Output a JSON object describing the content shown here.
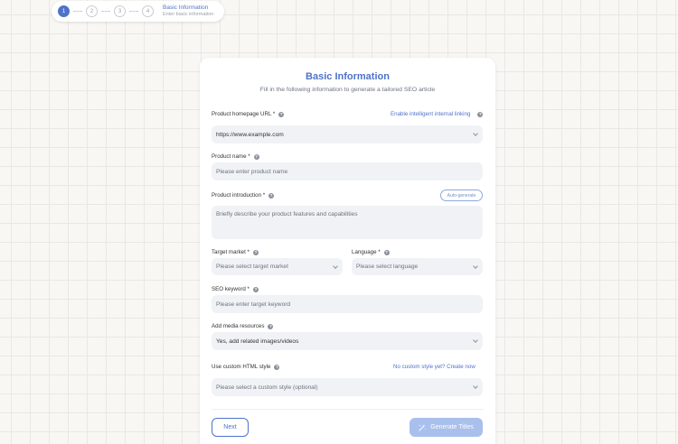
{
  "stepper": {
    "steps": [
      "1",
      "2",
      "3",
      "4"
    ],
    "active_step": 1,
    "current_title": "Basic Information",
    "current_subtitle": "Enter basic information"
  },
  "form": {
    "title": "Basic Information",
    "subtitle": "Fill in the following information to generate a tailored SEO article",
    "homepage_url": {
      "label": "Product homepage URL *",
      "link": "Enable intelligent internal linking",
      "value": "https://www.example.com"
    },
    "product_name": {
      "label": "Product name *",
      "placeholder": "Please enter product name"
    },
    "product_intro": {
      "label": "Product introduction *",
      "auto_generate": "Auto-generate",
      "placeholder": "Briefly describe your product features and capabilities"
    },
    "target_market": {
      "label": "Target market *",
      "placeholder": "Please select target market"
    },
    "language": {
      "label": "Language *",
      "placeholder": "Please select language"
    },
    "seo_keyword": {
      "label": "SEO keyword *",
      "placeholder": "Please enter target keyword"
    },
    "media": {
      "label": "Add media resources",
      "value": "Yes, add related images/videos"
    },
    "html_style": {
      "label": "Use custom HTML style",
      "link": "No custom style yet? Create now",
      "placeholder": "Please select a custom style (optional)"
    },
    "buttons": {
      "next": "Next",
      "generate": "Generate Titles"
    }
  },
  "colors": {
    "accent": "#4f73c9",
    "accent_disabled": "#a9c0ec",
    "field_bg": "#f1f2f5"
  }
}
